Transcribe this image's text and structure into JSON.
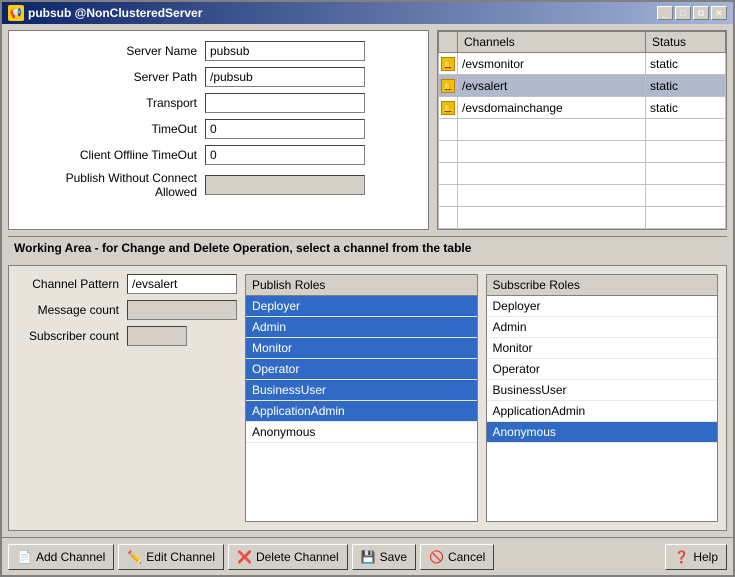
{
  "window": {
    "title": "pubsub @NonClusteredServer",
    "icon": "📢"
  },
  "titleButtons": [
    "_",
    "□",
    "⧉",
    "✕"
  ],
  "serverPanel": {
    "fields": [
      {
        "label": "Server Name",
        "value": "pubsub",
        "type": "white"
      },
      {
        "label": "Server Path",
        "value": "/pubsub",
        "type": "white"
      },
      {
        "label": "Transport",
        "value": "",
        "type": "white"
      },
      {
        "label": "TimeOut",
        "value": "0",
        "type": "white"
      },
      {
        "label": "Client Offline TimeOut",
        "value": "0",
        "type": "white"
      },
      {
        "label": "Publish Without Connect Allowed",
        "value": "",
        "type": "gray"
      }
    ]
  },
  "channelsTable": {
    "headers": [
      "Channels",
      "Status"
    ],
    "rows": [
      {
        "icon": true,
        "channel": "/evsmonitor",
        "status": "static",
        "selected": false
      },
      {
        "icon": true,
        "channel": "/evsalert",
        "status": "static",
        "selected": true
      },
      {
        "icon": true,
        "channel": "/evsdomainchange",
        "status": "static",
        "selected": false
      },
      {
        "icon": false,
        "channel": "",
        "status": "",
        "selected": false
      },
      {
        "icon": false,
        "channel": "",
        "status": "",
        "selected": false
      },
      {
        "icon": false,
        "channel": "",
        "status": "",
        "selected": false
      },
      {
        "icon": false,
        "channel": "",
        "status": "",
        "selected": false
      },
      {
        "icon": false,
        "channel": "",
        "status": "",
        "selected": false
      }
    ]
  },
  "workingArea": {
    "title": "Working Area - for Change and Delete Operation, select a channel from the table",
    "channelPattern": "/evsalert",
    "messageCount": "",
    "subscriberCount": ""
  },
  "publishRoles": {
    "header": "Publish Roles",
    "items": [
      {
        "label": "Deployer",
        "selected": true
      },
      {
        "label": "Admin",
        "selected": true
      },
      {
        "label": "Monitor",
        "selected": true
      },
      {
        "label": "Operator",
        "selected": true
      },
      {
        "label": "BusinessUser",
        "selected": true
      },
      {
        "label": "ApplicationAdmin",
        "selected": true
      },
      {
        "label": "Anonymous",
        "selected": false
      }
    ]
  },
  "subscribeRoles": {
    "header": "Subscribe Roles",
    "items": [
      {
        "label": "Deployer",
        "selected": false
      },
      {
        "label": "Admin",
        "selected": false
      },
      {
        "label": "Monitor",
        "selected": false
      },
      {
        "label": "Operator",
        "selected": false
      },
      {
        "label": "BusinessUser",
        "selected": false
      },
      {
        "label": "ApplicationAdmin",
        "selected": false
      },
      {
        "label": "Anonymous",
        "selected": true
      }
    ]
  },
  "buttons": {
    "addChannel": "Add Channel",
    "editChannel": "Edit Channel",
    "deleteChannel": "Delete Channel",
    "save": "Save",
    "cancel": "Cancel",
    "help": "Help"
  },
  "labels": {
    "channelPattern": "Channel Pattern",
    "messageCount": "Message count",
    "subscriberCount": "Subscriber count"
  }
}
